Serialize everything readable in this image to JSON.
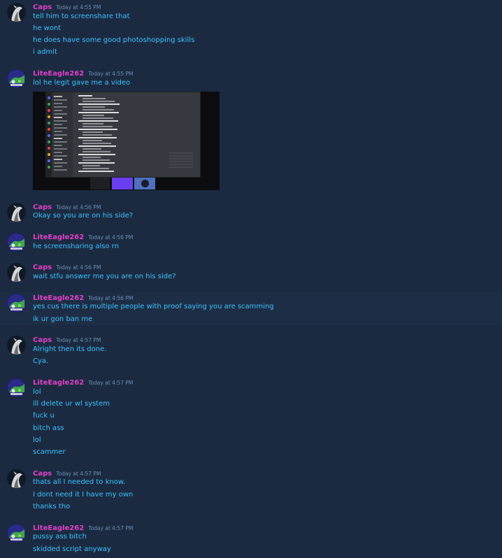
{
  "messages": [
    {
      "user": "Caps",
      "timestamp": "Today at 4:55 PM",
      "avatar_icon": "caps-avatar-icon",
      "lines": [
        "tell him to screenshare that",
        "he wont",
        "he does have some good photoshopping skills",
        "i admit"
      ]
    },
    {
      "user": "LiteEagle262",
      "timestamp": "Today at 4:55 PM",
      "avatar_icon": "liteeagle-avatar-icon",
      "lines": [
        "lol he legit gave me a video"
      ],
      "attachment": "video-attachment"
    },
    {
      "user": "Caps",
      "timestamp": "Today at 4:56 PM",
      "avatar_icon": "caps-avatar-icon",
      "lines": [
        "Okay so you are on his side?"
      ]
    },
    {
      "user": "LiteEagle262",
      "timestamp": "Today at 4:56 PM",
      "avatar_icon": "liteeagle-avatar-icon",
      "lines": [
        "he screensharing also rn"
      ]
    },
    {
      "user": "Caps",
      "timestamp": "Today at 4:56 PM",
      "avatar_icon": "caps-avatar-icon",
      "lines": [
        "wait stfu answer me you are on his side?"
      ]
    },
    {
      "user": "LiteEagle262",
      "timestamp": "Today at 4:56 PM",
      "avatar_icon": "liteeagle-avatar-icon",
      "lines": [
        "yes cus there is multiple people with proof saying you are scamming",
        "ik ur gon ban me"
      ]
    },
    {
      "user": "Caps",
      "timestamp": "Today at 4:57 PM",
      "avatar_icon": "caps-avatar-icon",
      "lines": [
        "Alright then its done.",
        "Cya."
      ]
    },
    {
      "user": "LiteEagle262",
      "timestamp": "Today at 4:57 PM",
      "avatar_icon": "liteeagle-avatar-icon",
      "lines": [
        "lol",
        "ill delete ur wl system",
        "fuck u",
        "bitch ass",
        "lol",
        "scammer"
      ]
    },
    {
      "user": "Caps",
      "timestamp": "Today at 4:57 PM",
      "avatar_icon": "caps-avatar-icon",
      "lines": [
        "thats all I needed to know.",
        "I dont need it I have my own",
        "thanks tho"
      ]
    },
    {
      "user": "LiteEagle262",
      "timestamp": "Today at 4:57 PM",
      "avatar_icon": "liteeagle-avatar-icon",
      "lines": [
        "pussy ass bitch",
        "skidded script anyway"
      ]
    }
  ],
  "colors": {
    "background": "#1b2a41",
    "highlight_row": "#1d2d45",
    "username": "#e040c8",
    "message_text": "#3cc3ff",
    "timestamp": "#6f8fb4"
  }
}
